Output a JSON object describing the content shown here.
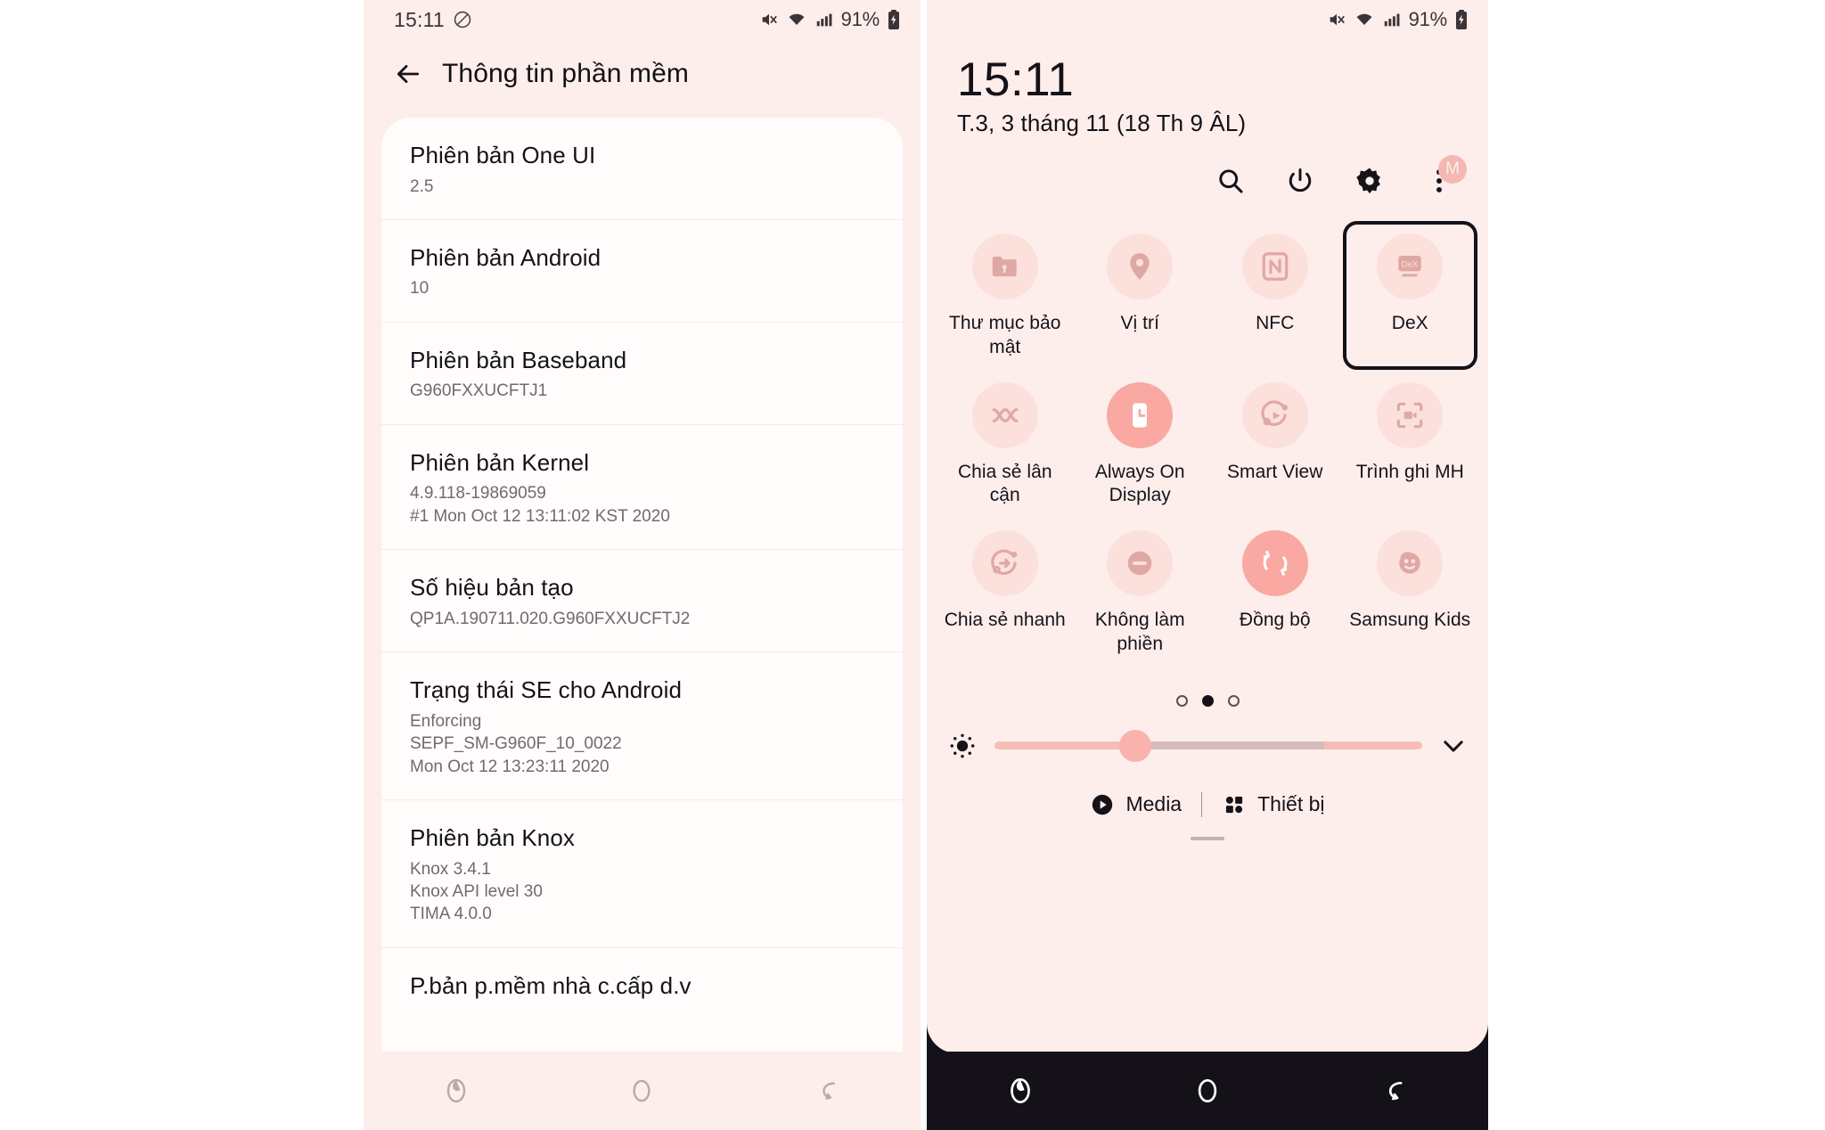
{
  "left_phone": {
    "status_bar": {
      "time": "15:11",
      "mute_icon": "do-not-disturb-icon",
      "vibrate_icon": "sound-off-icon",
      "wifi_icon": "wifi-icon",
      "signal_icon": "cellular-signal-icon",
      "battery_text": "91%",
      "battery_icon": "battery-charging-icon"
    },
    "header": {
      "back_icon": "back-arrow-icon",
      "title": "Thông tin phần mềm"
    },
    "items": [
      {
        "title": "Phiên bản One UI",
        "lines": [
          "2.5"
        ]
      },
      {
        "title": "Phiên bản Android",
        "lines": [
          "10"
        ]
      },
      {
        "title": "Phiên bản Baseband",
        "lines": [
          "G960FXXUCFTJ1"
        ]
      },
      {
        "title": "Phiên bản Kernel",
        "lines": [
          "4.9.118-19869059",
          "#1 Mon Oct 12 13:11:02 KST 2020"
        ]
      },
      {
        "title": "Số hiệu bản tạo",
        "lines": [
          "QP1A.190711.020.G960FXXUCFTJ2"
        ]
      },
      {
        "title": "Trạng thái SE cho Android",
        "lines": [
          "Enforcing",
          "SEPF_SM-G960F_10_0022",
          "Mon Oct 12 13:23:11 2020"
        ]
      },
      {
        "title": "Phiên bản Knox",
        "lines": [
          "Knox 3.4.1",
          "Knox API level 30",
          "TIMA 4.0.0"
        ]
      },
      {
        "title": "P.bản p.mềm nhà c.cấp d.v",
        "lines": []
      }
    ],
    "nav_bar": {
      "recents_icon": "recents-icon",
      "home_icon": "home-icon",
      "back_icon": "back-nav-icon"
    }
  },
  "right_phone": {
    "status_bar": {
      "vibrate_icon": "sound-off-icon",
      "wifi_icon": "wifi-icon",
      "signal_icon": "cellular-signal-icon",
      "battery_text": "91%",
      "battery_icon": "battery-charging-icon"
    },
    "clock": "15:11",
    "date": "T.3, 3 tháng 11 (18 Th 9 ÂL)",
    "header_icons": [
      {
        "name": "search-icon"
      },
      {
        "name": "power-icon"
      },
      {
        "name": "settings-gear-icon"
      },
      {
        "name": "overflow-menu-icon",
        "badge": "M"
      }
    ],
    "tiles": [
      [
        {
          "label": "Thư mục bảo mật",
          "icon": "secure-folder-icon",
          "active": false,
          "focused": false
        },
        {
          "label": "Vị trí",
          "icon": "location-pin-icon",
          "active": false,
          "focused": false
        },
        {
          "label": "NFC",
          "icon": "nfc-icon",
          "active": false,
          "focused": false
        },
        {
          "label": "DeX",
          "icon": "dex-icon",
          "active": false,
          "focused": true
        }
      ],
      [
        {
          "label": "Chia sẻ lân cận",
          "icon": "nearby-share-icon",
          "active": false,
          "focused": false
        },
        {
          "label": "Always On Display",
          "icon": "always-on-display-icon",
          "active": true,
          "focused": false
        },
        {
          "label": "Smart View",
          "icon": "smart-view-icon",
          "active": false,
          "focused": false
        },
        {
          "label": "Trình ghi MH",
          "icon": "screen-recorder-icon",
          "active": false,
          "focused": false
        }
      ],
      [
        {
          "label": "Chia sẻ nhanh",
          "icon": "quick-share-icon",
          "active": false,
          "focused": false
        },
        {
          "label": "Không làm phiền",
          "icon": "do-not-disturb-icon",
          "active": false,
          "focused": false
        },
        {
          "label": "Đồng bộ",
          "icon": "sync-icon",
          "active": true,
          "focused": false
        },
        {
          "label": "Samsung Kids",
          "icon": "samsung-kids-icon",
          "active": false,
          "focused": false
        }
      ]
    ],
    "page_dots": {
      "count": 3,
      "active_index": 1
    },
    "brightness": {
      "icon": "brightness-icon",
      "value_percent": 33,
      "expand_icon": "chevron-down-icon"
    },
    "footer": {
      "media_label": "Media",
      "media_icon": "play-circle-icon",
      "devices_label": "Thiết bị",
      "devices_icon": "grid-devices-icon"
    },
    "nav_bar": {
      "recents_icon": "recents-icon",
      "home_icon": "home-icon",
      "back_icon": "back-nav-icon"
    }
  },
  "colors": {
    "panel_bg": "#fdeeeb",
    "card_bg": "#fffcfb",
    "accent": "#f9a8a2",
    "tile_bg": "#fbe0dc",
    "nav_dark": "#141119",
    "text_primary": "#15121a",
    "text_secondary": "#6f6a70"
  }
}
